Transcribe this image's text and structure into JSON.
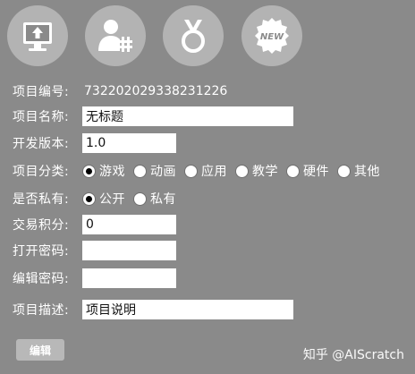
{
  "toolbar": {
    "icons": [
      "upload-monitor-icon",
      "user-hashtag-icon",
      "medal-icon",
      "new-badge-icon"
    ],
    "new_badge_text": "NEW"
  },
  "form": {
    "project_id": {
      "label": "项目编号:",
      "value": "732202029338231226"
    },
    "project_name": {
      "label": "项目名称:",
      "value": "无标题"
    },
    "version": {
      "label": "开发版本:",
      "value": "1.0"
    },
    "category": {
      "label": "项目分类:",
      "options": [
        "游戏",
        "动画",
        "应用",
        "教学",
        "硬件",
        "其他"
      ],
      "selected": "游戏"
    },
    "visibility": {
      "label": "是否私有:",
      "options": [
        "公开",
        "私有"
      ],
      "selected": "公开"
    },
    "points": {
      "label": "交易积分:",
      "value": "0"
    },
    "open_password": {
      "label": "打开密码:",
      "value": ""
    },
    "edit_password": {
      "label": "编辑密码:",
      "value": ""
    },
    "description": {
      "label": "项目描述:",
      "value": "项目说明"
    }
  },
  "edit_button": "编辑",
  "watermark": "知乎 @AIScratch"
}
